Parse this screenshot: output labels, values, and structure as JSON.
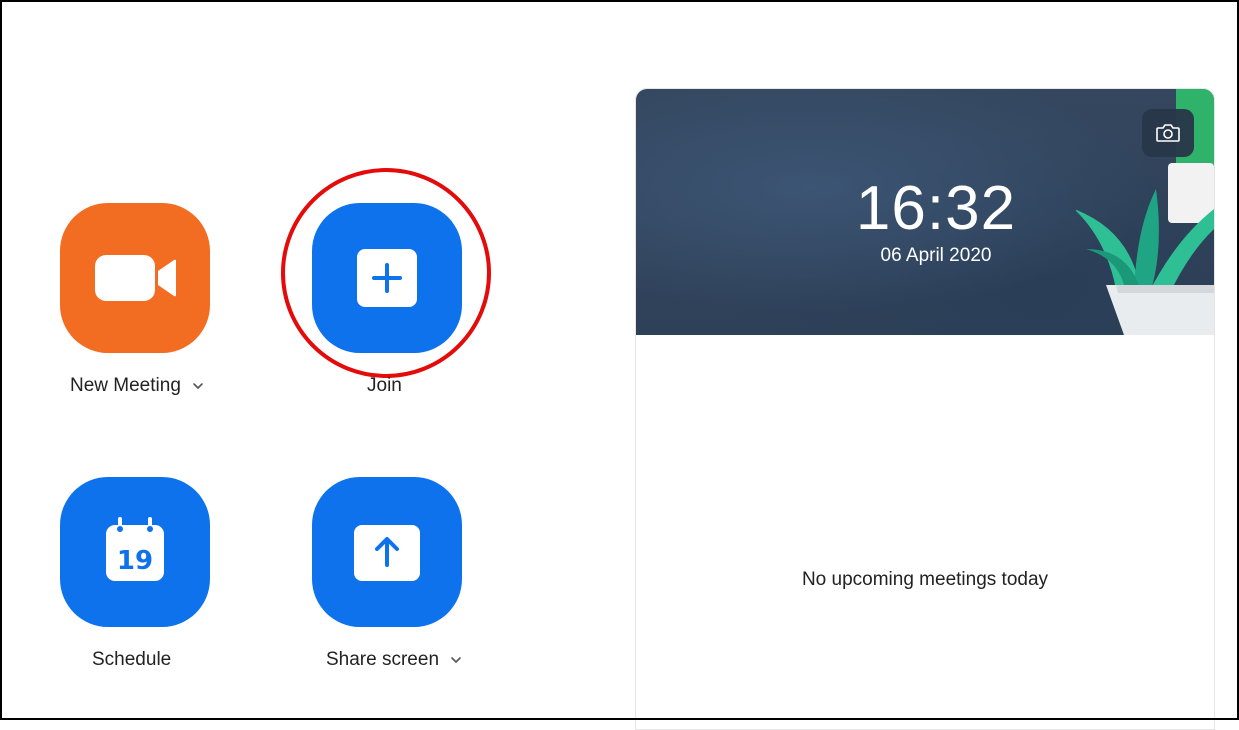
{
  "actions": {
    "new_meeting": {
      "label": "New Meeting",
      "color": "#f26d21",
      "icon": "video-camera-icon",
      "has_dropdown": true
    },
    "join": {
      "label": "Join",
      "color": "#0e72ed",
      "icon": "plus-icon",
      "highlighted": true
    },
    "schedule": {
      "label": "Schedule",
      "color": "#0e72ed",
      "icon": "calendar-icon",
      "calendar_day": "19"
    },
    "share_screen": {
      "label": "Share screen",
      "color": "#0e72ed",
      "icon": "upload-arrow-icon",
      "has_dropdown": true
    }
  },
  "panel": {
    "time": "16:32",
    "date": "06 April 2020",
    "camera_icon": "camera-icon",
    "empty_message": "No upcoming meetings today"
  },
  "colors": {
    "highlight_ring": "#e40b0b",
    "header_bg": "#34475f"
  }
}
